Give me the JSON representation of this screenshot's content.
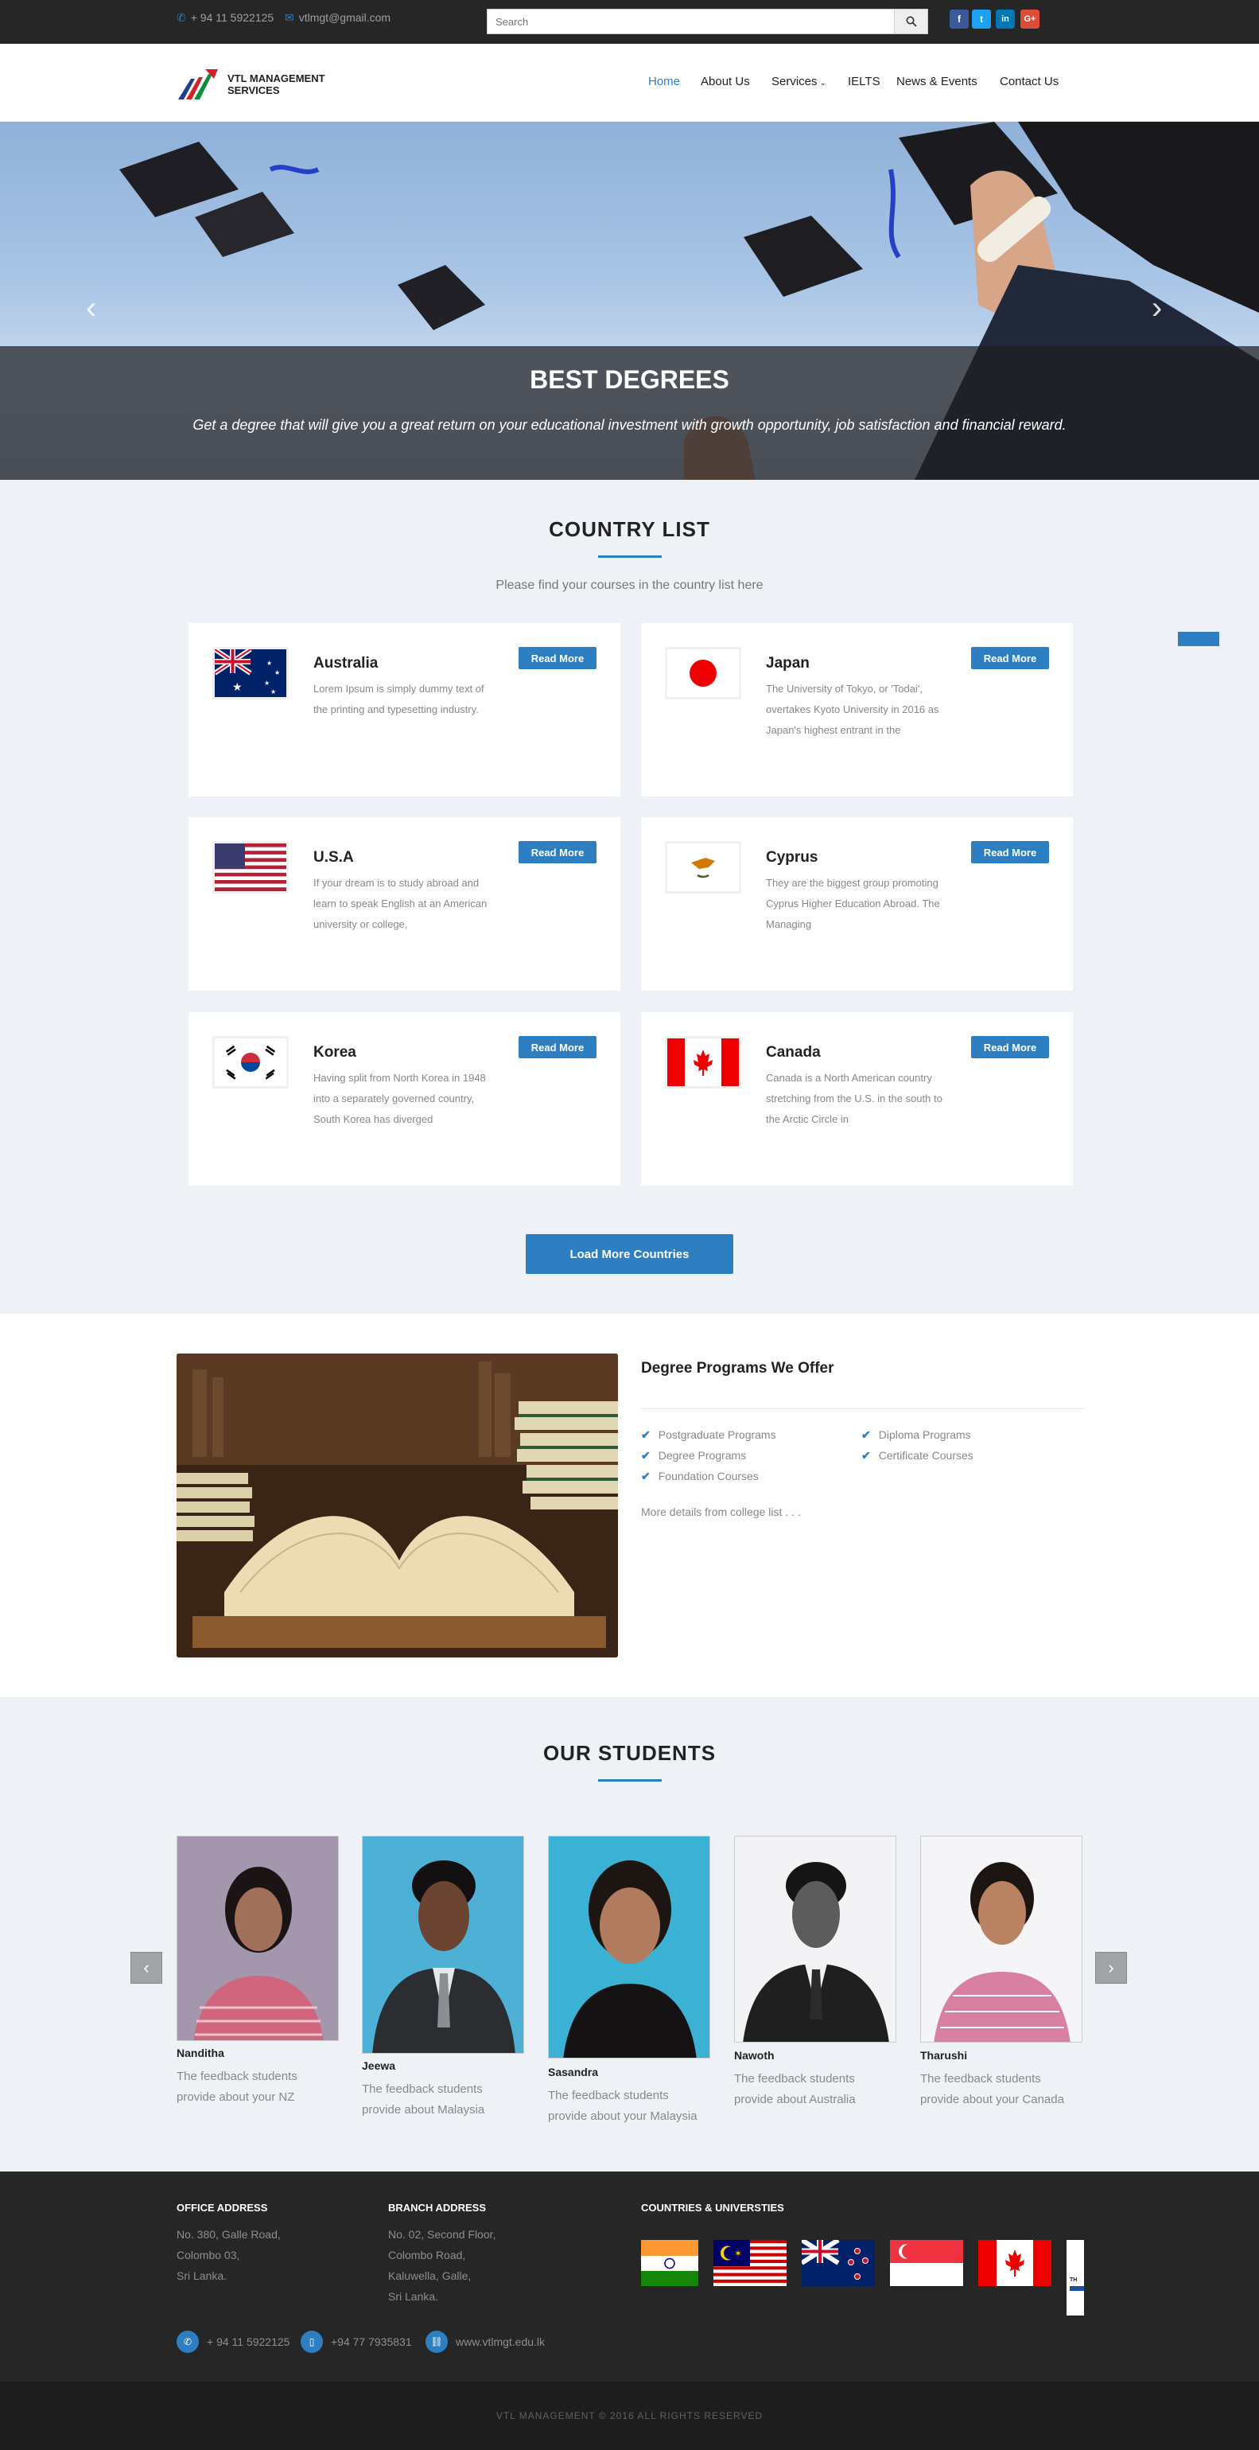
{
  "topbar": {
    "phone": "+ 94 11 5922125",
    "email": "vtlmgt@gmail.com",
    "search_placeholder": "Search",
    "social": [
      "f",
      "t",
      "in",
      "G+"
    ]
  },
  "brand": {
    "line1": "VTL MANAGEMENT",
    "line2": "SERVICES"
  },
  "nav": [
    "Home",
    "About Us",
    "Services",
    "IELTS",
    "News & Events",
    "Contact Us"
  ],
  "hero": {
    "title": "BEST DEGREES",
    "subtitle": "Get a degree that will give you a great return on your educational investment with growth opportunity, job satisfaction and financial reward."
  },
  "countries": {
    "title": "COUNTRY LIST",
    "subtitle": "Please find your courses in the country list here",
    "read_more": "Read More",
    "load_more": "Load More Countries",
    "items": [
      {
        "name": "Australia",
        "desc": "Lorem Ipsum is simply dummy text of the printing and typesetting industry."
      },
      {
        "name": "Japan",
        "desc": "The University of Tokyo, or 'Todai', overtakes Kyoto University in 2016 as Japan's highest entrant in the"
      },
      {
        "name": "U.S.A",
        "desc": "If your dream is to study abroad and learn to speak English at an American university or college,"
      },
      {
        "name": "Cyprus",
        "desc": "They are the biggest group promoting Cyprus Higher Education Abroad. The Managing"
      },
      {
        "name": "Korea",
        "desc": "Having split from North Korea in 1948 into a separately governed country, South Korea has diverged"
      },
      {
        "name": "Canada",
        "desc": "Canada is a North American country stretching from the U.S. in the south to the Arctic Circle in"
      }
    ]
  },
  "programs": {
    "title": "Degree Programs We Offer",
    "items": [
      "Postgraduate Programs",
      "Diploma Programs",
      "Degree Programs",
      "Certificate Courses",
      "Foundation Courses"
    ],
    "more": "More details from college list . . ."
  },
  "students": {
    "title": "OUR STUDENTS",
    "prev": "‹",
    "next": "›",
    "items": [
      {
        "name": "Nanditha",
        "feedback": "The feedback students provide about your NZ"
      },
      {
        "name": "Jeewa",
        "feedback": "The feedback students provide about Malaysia"
      },
      {
        "name": "Sasandra",
        "feedback": "The feedback students provide about your Malaysia"
      },
      {
        "name": "Nawoth",
        "feedback": "The feedback students provide about Australia"
      },
      {
        "name": "Tharushi",
        "feedback": "The feedback students provide about your Canada"
      }
    ]
  },
  "footer": {
    "office_title": "OFFICE ADDRESS",
    "office": [
      "No. 380, Galle Road,",
      "Colombo 03,",
      "Sri Lanka."
    ],
    "branch_title": "BRANCH ADDRESS",
    "branch": [
      "No. 02, Second Floor,",
      "Colombo Road,",
      "Kaluwella, Galle,",
      "Sri Lanka."
    ],
    "countries_title": "COUNTRIES & UNIVERSTIES",
    "phone": "+ 94 11 5922125",
    "mobile": "+94 77 7935831",
    "web": "www.vtlmgt.edu.lk",
    "copyright": "VTL MANAGEMENT © 2016 ALL RIGHTS RESERVED"
  },
  "colors": {
    "accent": "#2d7fc1",
    "dark": "#262626",
    "section_bg": "#eef2f6"
  }
}
